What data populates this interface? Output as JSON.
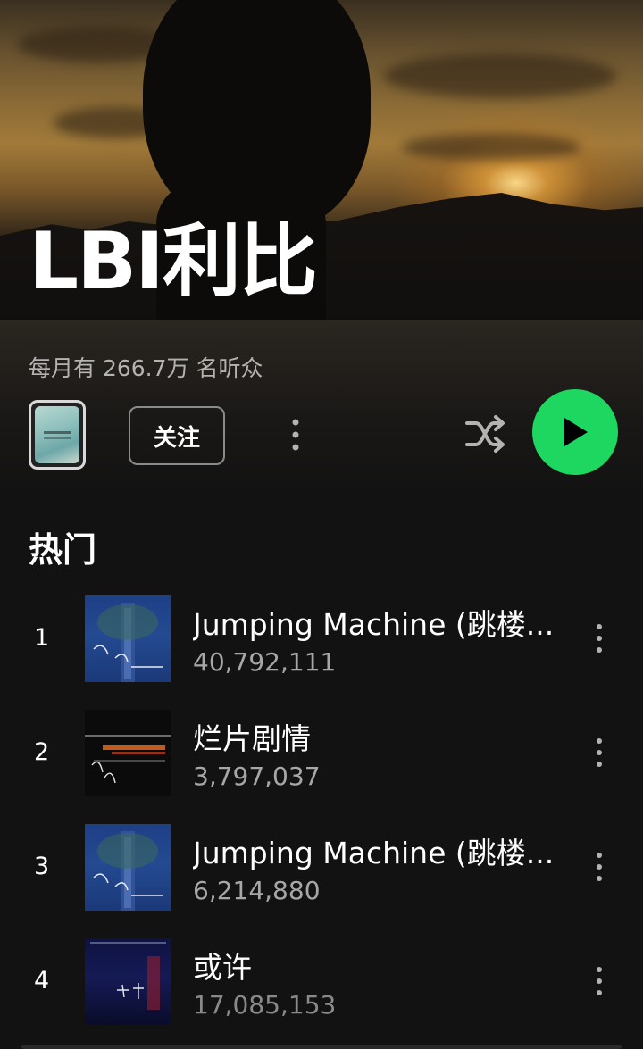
{
  "artist": {
    "name": "LBI利比",
    "monthly_listeners": "每月有 266.7万 名听众"
  },
  "actions": {
    "follow_label": "关注",
    "more_icon": "more-vertical-icon",
    "shuffle_icon": "shuffle-icon",
    "play_icon": "play-icon"
  },
  "colors": {
    "background": "#121212",
    "accent": "#1ed760",
    "secondary_text": "#a7a7a7"
  },
  "popular": {
    "title": "热门",
    "tracks": [
      {
        "index": "1",
        "title": "Jumping Machine (跳楼...",
        "plays": "40,792,111"
      },
      {
        "index": "2",
        "title": "烂片剧情",
        "plays": "3,797,037"
      },
      {
        "index": "3",
        "title": "Jumping Machine (跳楼...",
        "plays": "6,214,880"
      },
      {
        "index": "4",
        "title": "或许",
        "plays": "17,085,153"
      }
    ]
  }
}
